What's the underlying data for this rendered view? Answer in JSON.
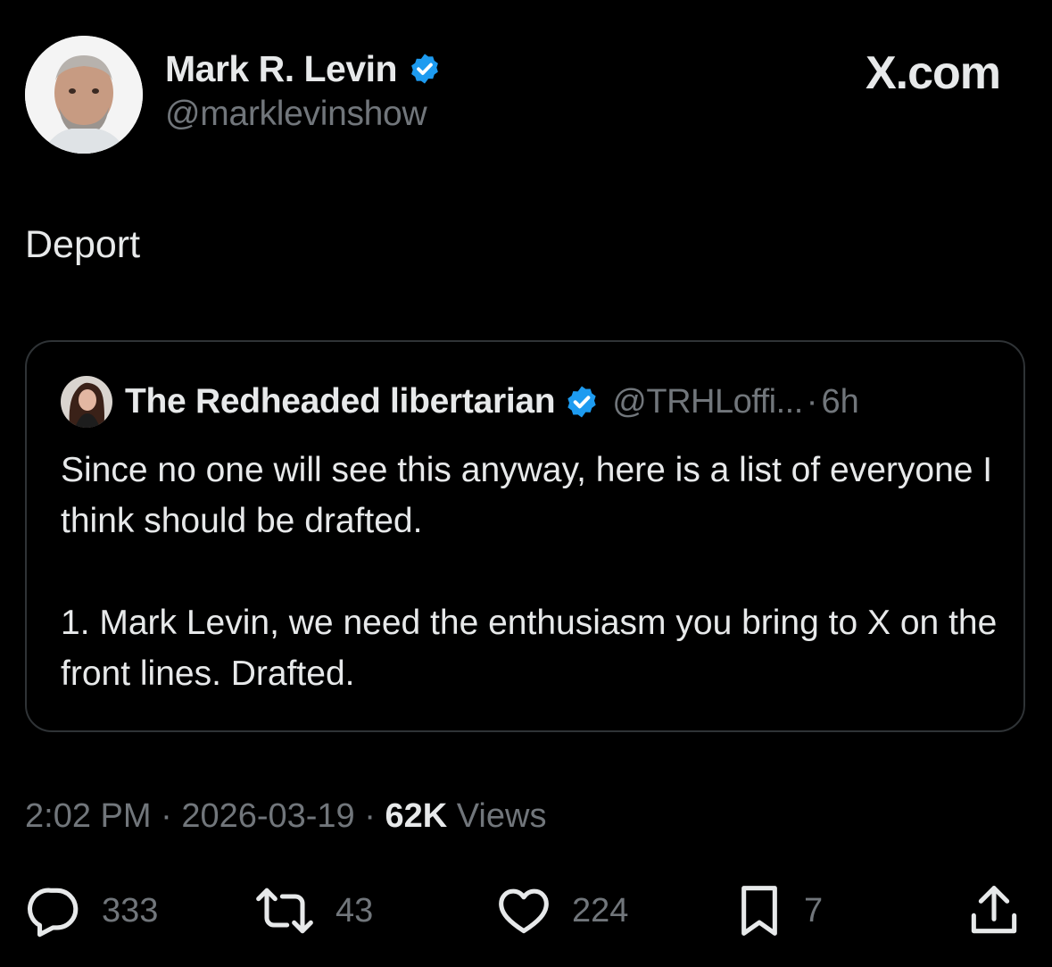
{
  "post": {
    "author_name": "Mark R. Levin",
    "author_handle": "@marklevinshow",
    "site_brand": "X.com",
    "text": "Deport",
    "timestamp_time": "2:02 PM",
    "timestamp_date": "2026-03-19",
    "views_count": "62K",
    "views_label": "Views"
  },
  "quoted_post": {
    "author_name": "The Redheaded libertarian",
    "author_handle": "@TRHLoffi...",
    "separator": "·",
    "age": "6h",
    "paragraph_1": "Since no one will see this anyway, here is a list of everyone I think should be drafted.",
    "paragraph_2": "1. Mark Levin, we need the enthusiasm you bring to X on the front lines. Drafted."
  },
  "actions": {
    "replies": {
      "icon": "reply-icon",
      "count": "333"
    },
    "reposts": {
      "icon": "repost-icon",
      "count": "43"
    },
    "likes": {
      "icon": "heart-icon",
      "count": "224"
    },
    "bookmarks": {
      "icon": "bookmark-icon",
      "count": "7"
    },
    "share": {
      "icon": "share-icon"
    }
  },
  "colors": {
    "background": "#000000",
    "primary_text": "#e7e9ea",
    "secondary_text": "#71767b",
    "verified_blue": "#1d9bf0",
    "card_border": "#2f3336"
  }
}
